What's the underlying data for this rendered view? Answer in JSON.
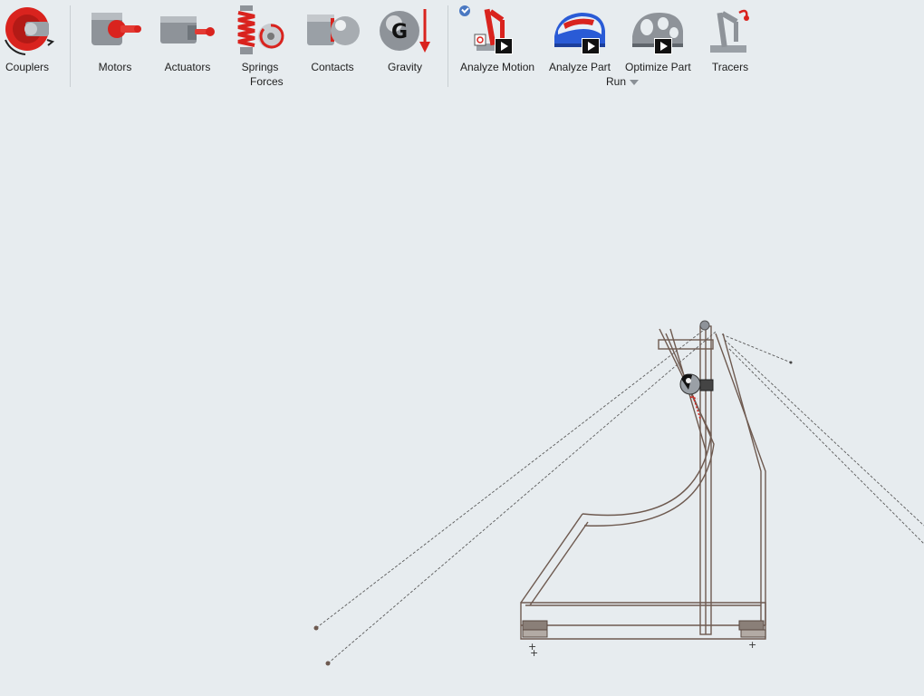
{
  "ribbon": {
    "tools": {
      "couplers": "Couplers",
      "motors": "Motors",
      "actuators": "Actuators",
      "springs": "Springs",
      "contacts": "Contacts",
      "gravity": "Gravity",
      "analyze_motion": "Analyze Motion",
      "analyze_part": "Analyze Part",
      "optimize_part": "Optimize Part",
      "tracers": "Tracers"
    },
    "groups": {
      "forces": "Forces",
      "run": "Run"
    },
    "gravity_icon_letter": "G"
  },
  "colors": {
    "background": "#e7ecef",
    "accent_red": "#d9231e",
    "model_brown": "#6e5a50"
  }
}
